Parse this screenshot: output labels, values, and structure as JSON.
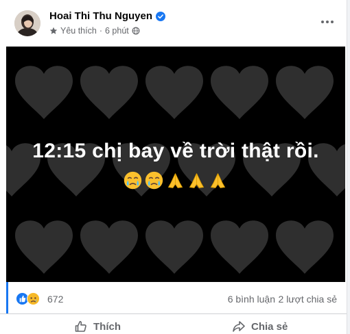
{
  "post": {
    "author": "Hoai Thi Thu Nguyen",
    "audience_label": "Yêu thích",
    "separator": "·",
    "time": "6 phút",
    "image_text": "12:15 chị bay về trời thật rồi.",
    "image_emojis": [
      "crying-face",
      "crying-face",
      "folded-hands",
      "folded-hands",
      "folded-hands"
    ]
  },
  "stats": {
    "reaction_icons": [
      "like",
      "sad"
    ],
    "reaction_count": "672",
    "comments": "6 bình luận",
    "shares": "2 lượt chia sẻ"
  },
  "actions": {
    "like_label": "Thích",
    "share_label": "Chia sẻ"
  },
  "colors": {
    "brand_blue": "#1877f2",
    "secondary_text": "#65676b",
    "image_background": "#000000",
    "heart": "#2f2f2f"
  }
}
